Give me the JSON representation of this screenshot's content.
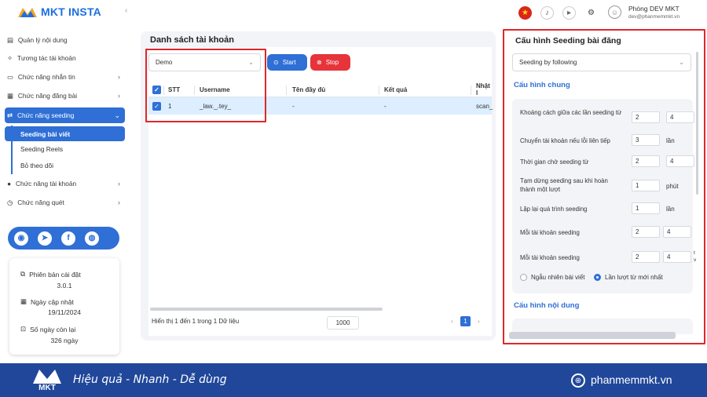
{
  "app": {
    "logo_text": "MKT INSTA"
  },
  "sidebar": {
    "items": [
      {
        "label": "Quản lý nội dung",
        "icon": "book-icon"
      },
      {
        "label": "Tương tác tài khoản",
        "icon": "sparkle-icon"
      },
      {
        "label": "Chức năng nhắn tin",
        "icon": "chat-icon"
      },
      {
        "label": "Chức năng đăng bài",
        "icon": "calendar-icon"
      },
      {
        "label": "Chức năng seeding",
        "icon": "seeding-icon"
      },
      {
        "label": "Chức năng tài khoản",
        "icon": "user-icon"
      },
      {
        "label": "Chức năng quét",
        "icon": "scan-icon"
      }
    ],
    "subitems": [
      "Seeding bài viết",
      "Seeding Reels",
      "Bỏ theo dõi"
    ],
    "info": {
      "version_label": "Phiên bản cài đặt",
      "version": "3.0.1",
      "update_label": "Ngày cập nhật",
      "update": "19/11/2024",
      "days_label": "Số ngày còn lại",
      "days": "326 ngày"
    }
  },
  "topbar": {
    "user_name": "Phòng DEV MKT",
    "user_email": "dev@phanmemmkt.vn"
  },
  "accounts": {
    "title": "Danh sách tài khoản",
    "group_select": "Demo",
    "start_label": "Start",
    "stop_label": "Stop",
    "columns": [
      "STT",
      "Username",
      "Tên đầy đủ",
      "Kết quả",
      "Nhật l"
    ],
    "rows": [
      {
        "stt": "1",
        "username": "_law._.tey_",
        "fullname": "-",
        "result": "-",
        "log": "scan_"
      }
    ],
    "footer": "Hiển thị 1 đến 1 trong 1 Dữ liệu",
    "page_size": "1000",
    "current_page": "1"
  },
  "seeding": {
    "title": "Cấu hình Seeding bài đăng",
    "mode_select": "Seeding by following",
    "general_title": "Cấu hình chung",
    "fields": [
      {
        "label": "Khoảng cách giữa các lần seeding từ",
        "v1": "2",
        "v2": "4",
        "unit": ""
      },
      {
        "label": "Chuyển tài khoản nếu lỗi liên tiếp",
        "v1": "3",
        "v2": "",
        "unit": "lần"
      },
      {
        "label": "Thời gian chờ seeding từ",
        "v1": "2",
        "v2": "4",
        "unit": ""
      },
      {
        "label": "Tạm dừng seeding sau khi hoàn thành một lượt",
        "v1": "1",
        "v2": "",
        "unit": "phút"
      },
      {
        "label": "Lặp lại quá trình seeding",
        "v1": "1",
        "v2": "",
        "unit": "lần"
      },
      {
        "label": "Mỗi tài khoản seeding",
        "v1": "2",
        "v2": "4",
        "unit": ""
      },
      {
        "label": "Mỗi tài khoản seeding",
        "v1": "2",
        "v2": "4",
        "unit": "t v"
      }
    ],
    "radio_random": "Ngẫu nhiên bài viết",
    "radio_sequential": "Lần lượt từ mới nhất",
    "content_title": "Cấu hình nội dung"
  },
  "banner": {
    "slogan": "Hiệu quả - Nhanh - Dễ dùng",
    "website": "phanmemmkt.vn",
    "logo_text": "MKT"
  }
}
